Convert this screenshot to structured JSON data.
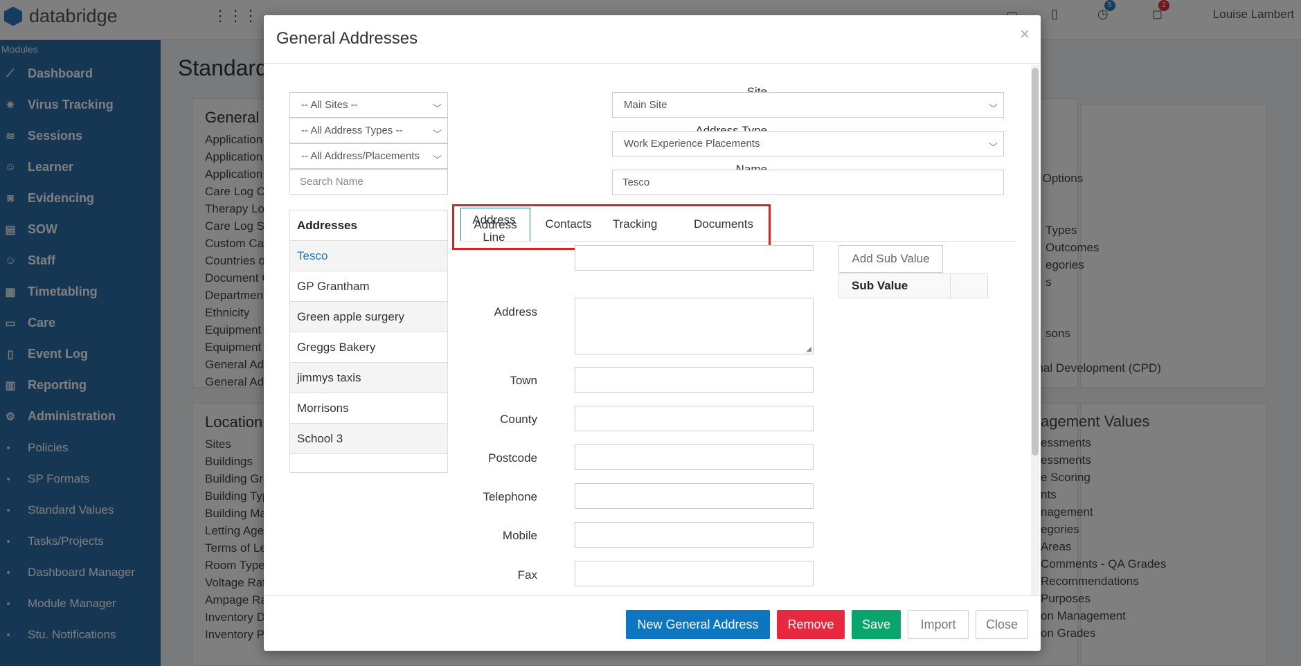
{
  "app": {
    "brand": "databridge",
    "user": "Louise Lambert",
    "badges": [
      "5",
      "2"
    ],
    "page_title": "Standard Values",
    "sidebar_label": "Modules",
    "sidebar": [
      {
        "label": "Dashboard",
        "icon": "chart-line-icon"
      },
      {
        "label": "Virus Tracking",
        "icon": "virus-icon"
      },
      {
        "label": "Sessions",
        "icon": "layers-icon"
      },
      {
        "label": "Learner",
        "icon": "user-icon"
      },
      {
        "label": "Evidencing",
        "icon": "camera-icon"
      },
      {
        "label": "SOW",
        "icon": "book-icon"
      },
      {
        "label": "Staff",
        "icon": "user-icon"
      },
      {
        "label": "Timetabling",
        "icon": "calendar-icon"
      },
      {
        "label": "Care",
        "icon": "id-card-icon"
      },
      {
        "label": "Event Log",
        "icon": "clipboard-icon"
      },
      {
        "label": "Reporting",
        "icon": "bar-chart-icon"
      },
      {
        "label": "Administration",
        "icon": "gear-icon"
      }
    ],
    "sidebar_sub": [
      "Policies",
      "SP Formats",
      "Standard Values",
      "Tasks/Projects",
      "Dashboard Manager",
      "Module Manager",
      "Stu. Notifications"
    ],
    "panel1": {
      "title": "General V",
      "links": [
        "Application",
        "Application",
        "Application",
        "Care Log Ca",
        "Therapy Log",
        "Care Log St",
        "Custom Car",
        "Countries o",
        "Document C",
        "Departmen",
        "Ethnicity",
        "Equipment",
        "Equipment",
        "General Ad",
        "General Ad"
      ]
    },
    "panel2": {
      "title": "Location",
      "links": [
        "Sites",
        "Buildings",
        "Building Gr",
        "Building Typ",
        "Building Ma",
        "Letting Age",
        "Terms of Le",
        "Room Type",
        "Voltage Rat",
        "Ampage Ra",
        "Inventory D",
        "Inventory P"
      ]
    },
    "right_top": [
      "ed Options",
      "Types",
      "Outcomes",
      "egories",
      "s",
      "sons",
      "onal Development (CPD)"
    ],
    "right_bottom_title": "agement Values",
    "right_bottom": [
      "essments",
      "essments",
      "e Scoring",
      "nts",
      "nagement",
      "egories",
      "Areas",
      "Comments - QA Grades",
      "Recommendations",
      "Purposes",
      "on Management",
      "on Grades"
    ]
  },
  "modal": {
    "title": "General Addresses",
    "close": "×",
    "filters": {
      "sites": "-- All Sites --",
      "address_types": "-- All Address Types --",
      "placements": "-- All Address/Placements",
      "search_placeholder": "Search Name"
    },
    "list_header": "Addresses",
    "addresses": [
      "Tesco",
      "GP Grantham",
      "Green apple surgery",
      "Greggs Bakery",
      "jimmys taxis",
      "Morrisons",
      "School 3"
    ],
    "form": {
      "site_label": "Site",
      "site_value": "Main Site",
      "type_label": "Address Type",
      "type_value": "Work Experience Placements",
      "name_label": "Name",
      "name_value": "Tesco"
    },
    "tabs": [
      "Address",
      "Contacts",
      "Tracking",
      "Documents"
    ],
    "fields": {
      "address_line": "Address\nLine",
      "address": "Address",
      "town": "Town",
      "county": "County",
      "postcode": "Postcode",
      "telephone": "Telephone",
      "mobile": "Mobile",
      "fax": "Fax"
    },
    "add_sub_value": "Add Sub Value",
    "sub_value_header": "Sub Value",
    "footer": {
      "new": "New General Address",
      "remove": "Remove",
      "save": "Save",
      "import": "Import",
      "close": "Close"
    },
    "colors": {
      "primary": "#0d76c0",
      "danger": "#e8283f",
      "success": "#0aa56c",
      "highlight": "#e02020"
    }
  }
}
